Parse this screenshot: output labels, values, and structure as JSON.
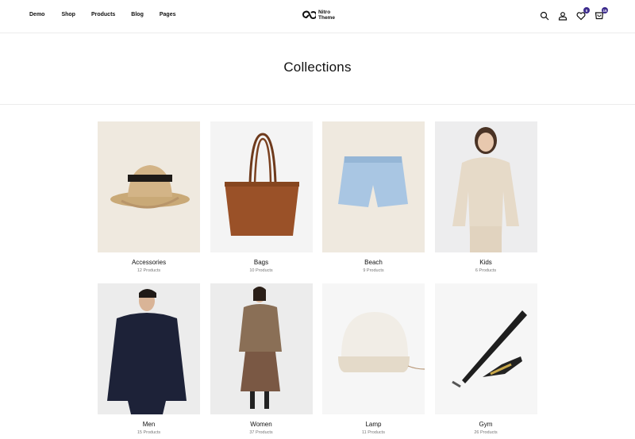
{
  "nav": {
    "items": [
      "Demo",
      "Shop",
      "Products",
      "Blog",
      "Pages"
    ]
  },
  "brand": {
    "line1": "Nitro",
    "line2": "Theme"
  },
  "header_icons": {
    "search": "search-icon",
    "account": "user-icon",
    "wishlist": {
      "icon": "heart-icon",
      "badge": "0"
    },
    "cart": {
      "icon": "cart-icon",
      "badge": "15"
    }
  },
  "page": {
    "title": "Collections"
  },
  "accent_color": "#3d2c8d",
  "collections": [
    {
      "name": "Accessories",
      "count": "12 Products",
      "bg": "#efe9df"
    },
    {
      "name": "Bags",
      "count": "10 Products",
      "bg": "#f4f4f4"
    },
    {
      "name": "Beach",
      "count": "9 Products",
      "bg": "#efe9df"
    },
    {
      "name": "Kids",
      "count": "6 Products",
      "bg": "#ededee"
    },
    {
      "name": "Men",
      "count": "15 Products",
      "bg": "#ececec"
    },
    {
      "name": "Women",
      "count": "37 Products",
      "bg": "#ececec"
    },
    {
      "name": "Lamp",
      "count": "11 Products",
      "bg": "#f6f6f6"
    },
    {
      "name": "Gym",
      "count": "26 Products",
      "bg": "#f6f6f6"
    }
  ]
}
